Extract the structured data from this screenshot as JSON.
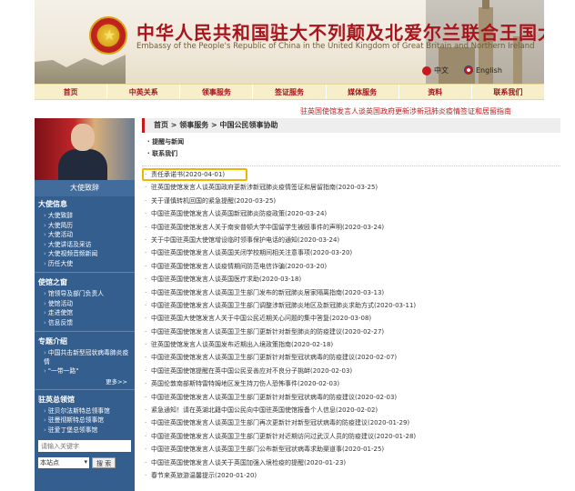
{
  "header": {
    "title_cn": "中华人民共和国驻大不列颠及北爱尔兰联合王国大使馆",
    "title_en": "Embassy of the People's Republic of China in the United Kingdom of Great Britain and Northern Ireland",
    "lang_cn": "中文",
    "lang_en": "English"
  },
  "nav": [
    "首页",
    "中英关系",
    "领事服务",
    "签证服务",
    "媒体服务",
    "资料",
    "联系我们"
  ],
  "marquee": "驻英国使馆发言人谈英国政府更新涉新冠肺炎疫情签证和居留指南",
  "sidebar": {
    "photo_caption": "大使致辞",
    "sections": [
      {
        "title": "大使信息",
        "items": [
          "大使致辞",
          "大使简历",
          "大使活动",
          "大使讲话及采访",
          "大使视频音频新闻",
          "历任大使"
        ],
        "more": ""
      },
      {
        "title": "使馆之窗",
        "items": [
          "馆领导及部门负责人",
          "使馆活动",
          "走进使馆",
          "信息反馈"
        ],
        "more": ""
      },
      {
        "title": "专题介绍",
        "items": [
          "中国共击新型冠状病毒肺炎疫情",
          "\"一带一路\""
        ],
        "more": "更多>>"
      },
      {
        "title": "驻英总领馆",
        "items": [
          "驻贝尔法斯特总领事馆",
          "驻曼彻斯特总领事馆",
          "驻爱丁堡总领事馆"
        ],
        "more": ""
      }
    ],
    "search_placeholder": "请输入关键字",
    "scope": "本站点",
    "search_button": "搜 索"
  },
  "main": {
    "breadcrumb": "首页 > 领事服务 > 中国公民领事协助",
    "sub_links": [
      "提醒与新闻",
      "联系我们"
    ],
    "items": [
      "责任承诺书(2020-04-01)",
      "驻英国使馆发言人谈英国政府更新涉新冠肺炎疫情签证和居留指南(2020-03-25)",
      "关于谨慎转机回国的紧急提醒(2020-03-25)",
      "中国驻英国使馆发言人谈英国新冠肺炎防疫政策(2020-03-24)",
      "中国驻英国使馆发言人关于南安普顿大学中国留学生被殴事件的声明(2020-03-24)",
      "关于中国驻英国大使馆增设临时领事保护电话的通知(2020-03-24)",
      "中国驻英国使馆发言人谈英国关闭学校期间相关注意事项(2020-03-20)",
      "中国驻英国使馆发言人谈疫情期间防范电信诈骗(2020-03-20)",
      "中国驻英国使馆发言人谈英国医疗求助(2020-03-18)",
      "中国驻英国使馆发言人谈英国卫生部门发布的新冠肺炎居家隔离指南(2020-03-13)",
      "中国驻英国使馆发言人谈英国卫生部门调整涉新冠肺炎地区及新冠肺炎求助方式(2020-03-11)",
      "中国驻英国大使馆发言人关于中国公民近期关心问题的集中答复(2020-03-08)",
      "中国驻英国使馆发言人谈英国卫生部门更新针对新型肺炎的防疫建议(2020-02-27)",
      "驻英国使馆发言人谈英国发布近期出入境政策指南(2020-02-18)",
      "中国驻英国使馆发言人谈英国卫生部门更新针对新型冠状病毒的防疫建议(2020-02-07)",
      "中国驻英国使馆提醒在英中国公民妥善应对不良分子挑衅(2020-02-03)",
      "英国伦敦南部斯特雷特姆地区发生持刀伤人恐怖事件(2020-02-03)",
      "中国驻英国使馆发言人谈英国卫生部门更新针对新型冠状病毒的防疫建议(2020-02-03)",
      "紧急通知！请在英湖北籍中国公民向中国驻英国使馆报备个人信息(2020-02-02)",
      "中国驻英国使馆发言人谈英国卫生部门再次更新针对新型冠状病毒的防疫建议(2020-01-29)",
      "中国驻英国使馆发言人谈英国卫生部门更新针对近期访问过武汉人员的防疫建议(2020-01-28)",
      "中国驻英国使馆发言人谈英国卫生部门公布新型冠状病毒求助渠道事(2020-01-25)",
      "中国驻英国使馆发言人谈关于英国加强入境检疫的提醒(2020-01-23)",
      "春节来英旅游温馨提示(2020-01-20)"
    ]
  }
}
